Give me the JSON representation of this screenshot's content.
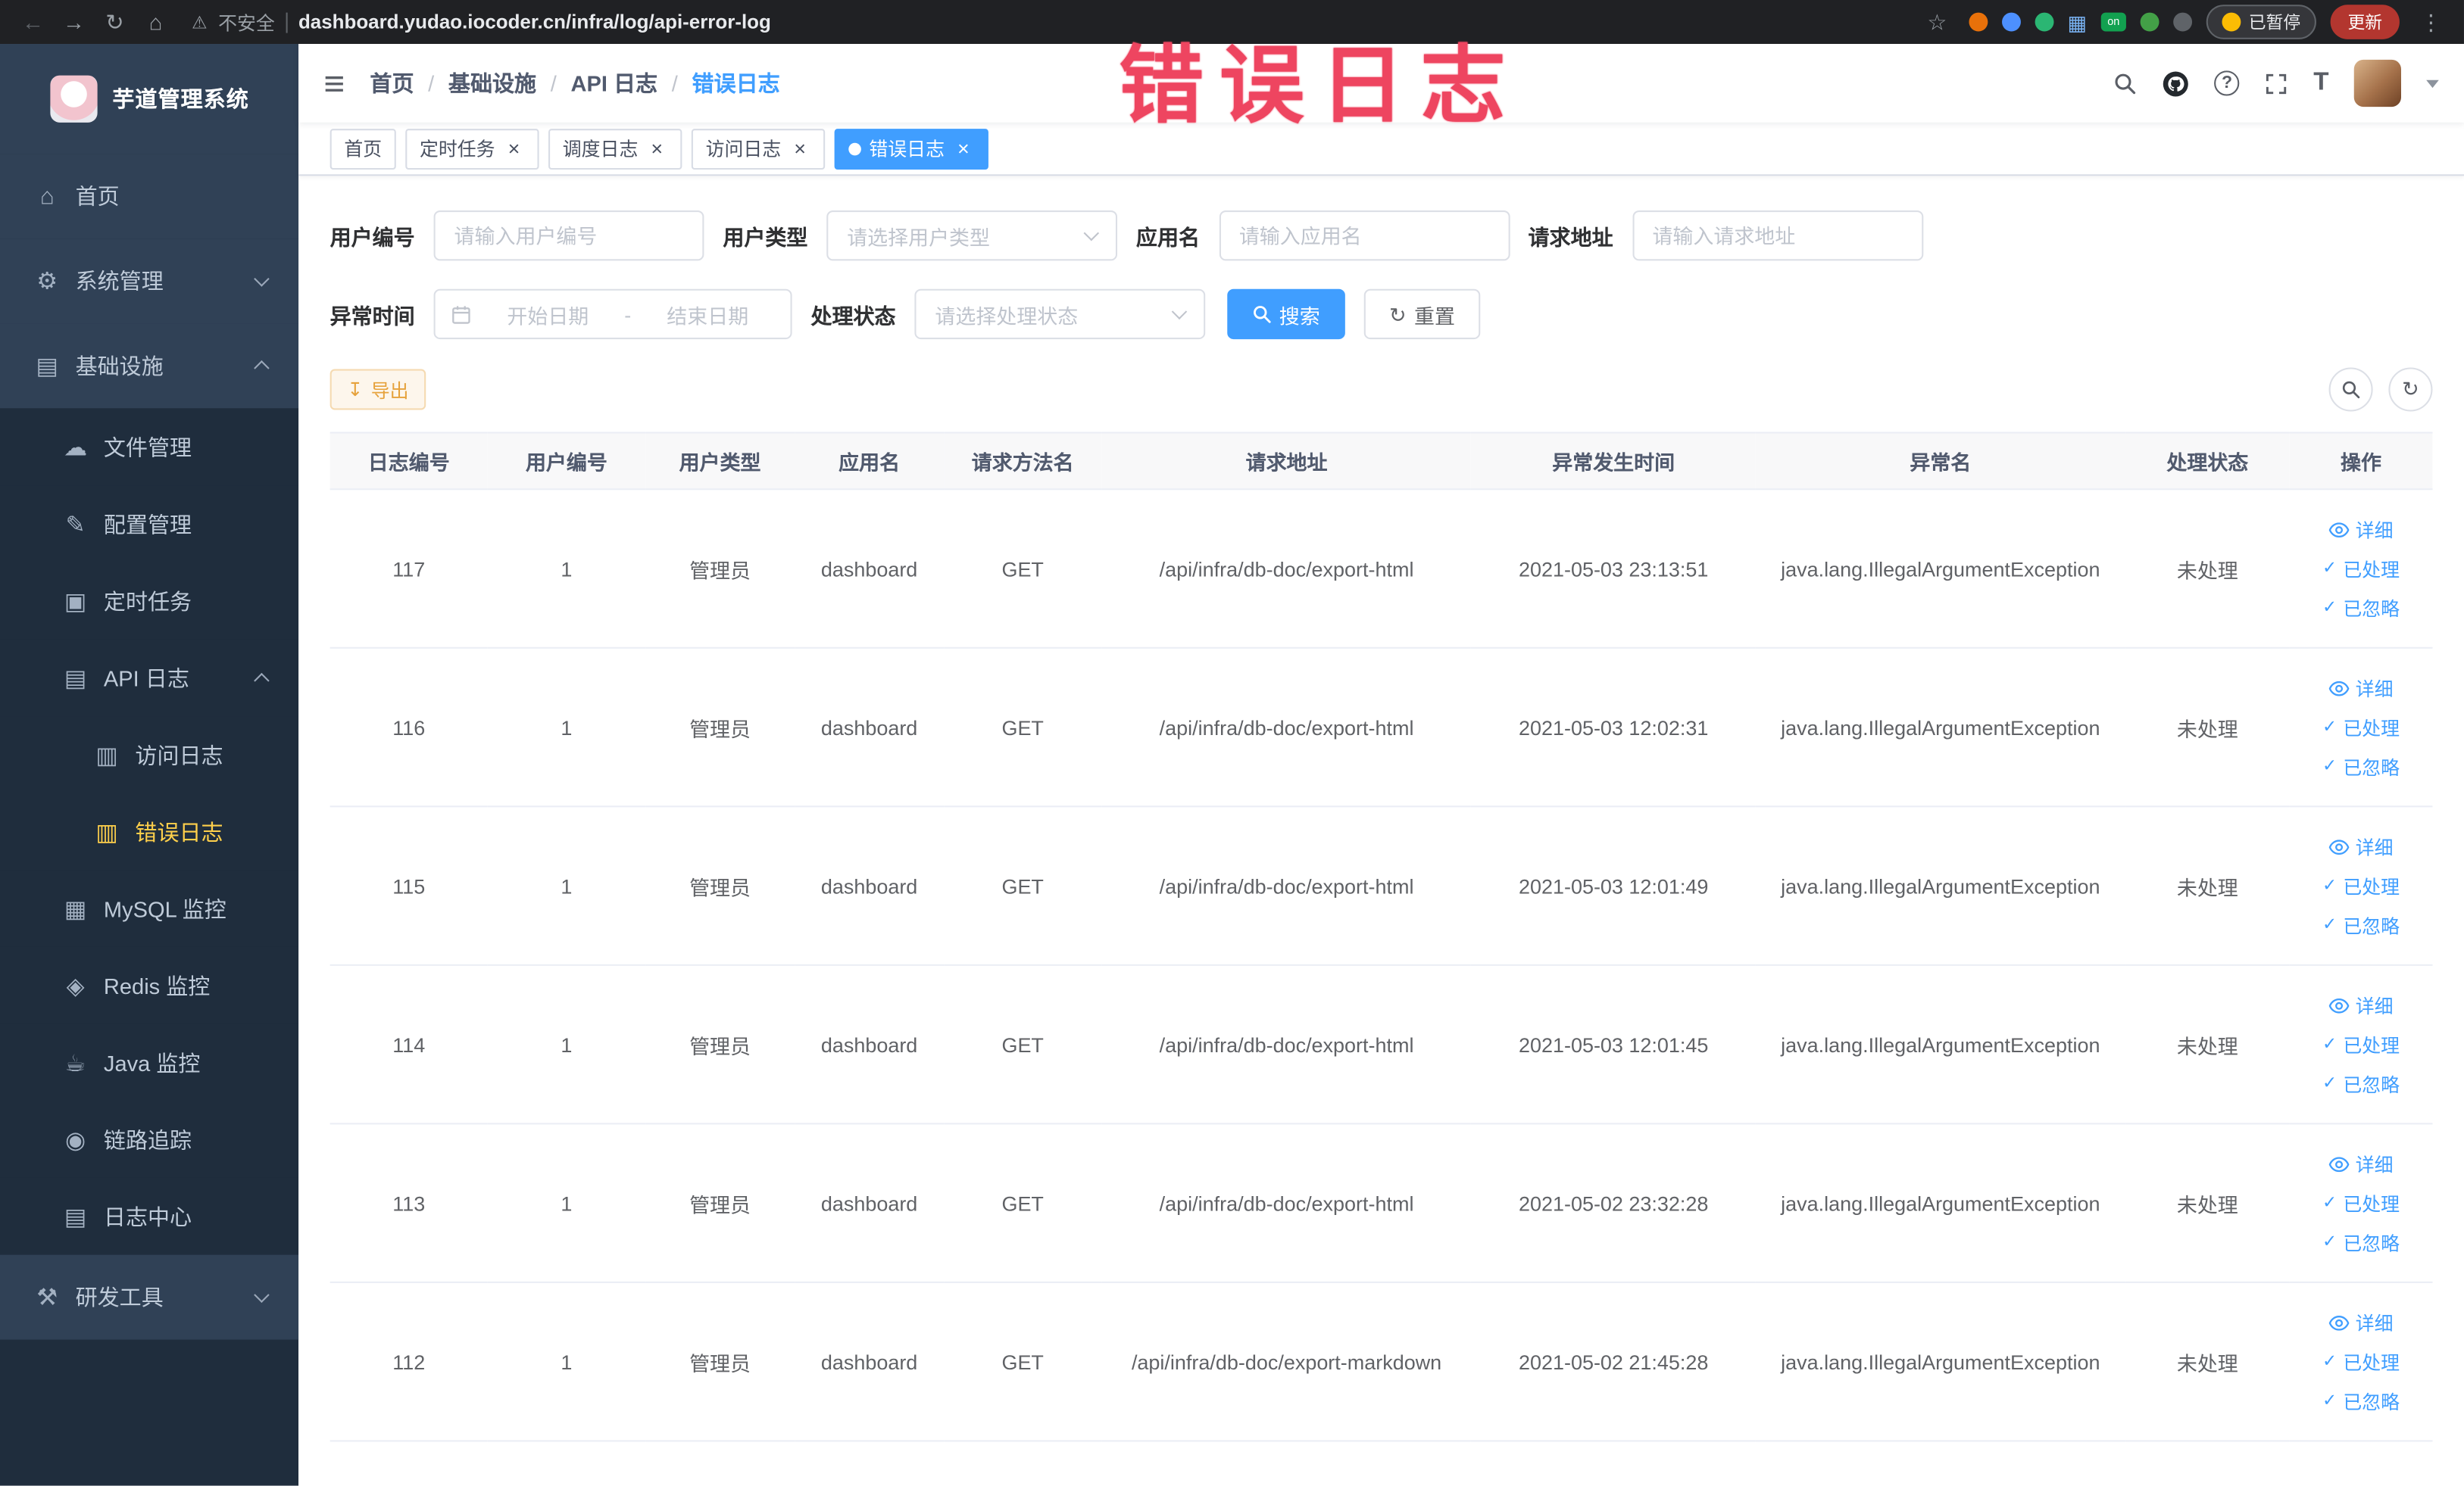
{
  "browser": {
    "security_label": "不安全",
    "url": "dashboard.yudao.iocoder.cn/infra/log/api-error-log",
    "extension_badge": "on",
    "paused_badge": "已暂停",
    "update_button": "更新"
  },
  "annotation": {
    "watermark": "错误日志"
  },
  "sidebar": {
    "app_title": "芋道管理系统",
    "items": {
      "home": "首页",
      "system": "系统管理",
      "infra": "基础设施",
      "file": "文件管理",
      "config": "配置管理",
      "job": "定时任务",
      "api_log": "API 日志",
      "access_log": "访问日志",
      "error_log": "错误日志",
      "mysql": "MySQL 监控",
      "redis": "Redis 监控",
      "java": "Java 监控",
      "trace": "链路追踪",
      "log_center": "日志中心",
      "dev_tools": "研发工具"
    }
  },
  "breadcrumb": {
    "items": [
      "首页",
      "基础设施",
      "API 日志",
      "错误日志"
    ]
  },
  "tabs": [
    {
      "label": "首页"
    },
    {
      "label": "定时任务"
    },
    {
      "label": "调度日志"
    },
    {
      "label": "访问日志"
    },
    {
      "label": "错误日志"
    }
  ],
  "filters": {
    "user_id_label": "用户编号",
    "user_id_placeholder": "请输入用户编号",
    "user_type_label": "用户类型",
    "user_type_placeholder": "请选择用户类型",
    "app_name_label": "应用名",
    "app_name_placeholder": "请输入应用名",
    "request_url_label": "请求地址",
    "request_url_placeholder": "请输入请求地址",
    "time_label": "异常时间",
    "time_start_placeholder": "开始日期",
    "time_separator": "-",
    "time_end_placeholder": "结束日期",
    "status_label": "处理状态",
    "status_placeholder": "请选择处理状态",
    "search_button": "搜索",
    "reset_button": "重置"
  },
  "toolbar": {
    "export_button": "导出"
  },
  "table": {
    "columns": [
      "日志编号",
      "用户编号",
      "用户类型",
      "应用名",
      "请求方法名",
      "请求地址",
      "异常发生时间",
      "异常名",
      "处理状态",
      "操作"
    ],
    "rows": [
      {
        "id": "117",
        "user_id": "1",
        "user_type": "管理员",
        "app": "dashboard",
        "method": "GET",
        "url": "/api/infra/db-doc/export-html",
        "time": "2021-05-03 23:13:51",
        "exception": "java.lang.IllegalArgumentException",
        "status": "未处理"
      },
      {
        "id": "116",
        "user_id": "1",
        "user_type": "管理员",
        "app": "dashboard",
        "method": "GET",
        "url": "/api/infra/db-doc/export-html",
        "time": "2021-05-03 12:02:31",
        "exception": "java.lang.IllegalArgumentException",
        "status": "未处理"
      },
      {
        "id": "115",
        "user_id": "1",
        "user_type": "管理员",
        "app": "dashboard",
        "method": "GET",
        "url": "/api/infra/db-doc/export-html",
        "time": "2021-05-03 12:01:49",
        "exception": "java.lang.IllegalArgumentException",
        "status": "未处理"
      },
      {
        "id": "114",
        "user_id": "1",
        "user_type": "管理员",
        "app": "dashboard",
        "method": "GET",
        "url": "/api/infra/db-doc/export-html",
        "time": "2021-05-03 12:01:45",
        "exception": "java.lang.IllegalArgumentException",
        "status": "未处理"
      },
      {
        "id": "113",
        "user_id": "1",
        "user_type": "管理员",
        "app": "dashboard",
        "method": "GET",
        "url": "/api/infra/db-doc/export-html",
        "time": "2021-05-02 23:32:28",
        "exception": "java.lang.IllegalArgumentException",
        "status": "未处理"
      },
      {
        "id": "112",
        "user_id": "1",
        "user_type": "管理员",
        "app": "dashboard",
        "method": "GET",
        "url": "/api/infra/db-doc/export-markdown",
        "time": "2021-05-02 21:45:28",
        "exception": "java.lang.IllegalArgumentException",
        "status": "未处理"
      }
    ],
    "actions": {
      "detail": "详细",
      "processed": "已处理",
      "ignored": "已忽略"
    }
  },
  "colors": {
    "primary": "#409eff",
    "warning": "#e6a23c",
    "sidebar_active": "#ffd04b",
    "watermark": "#ee4560"
  }
}
